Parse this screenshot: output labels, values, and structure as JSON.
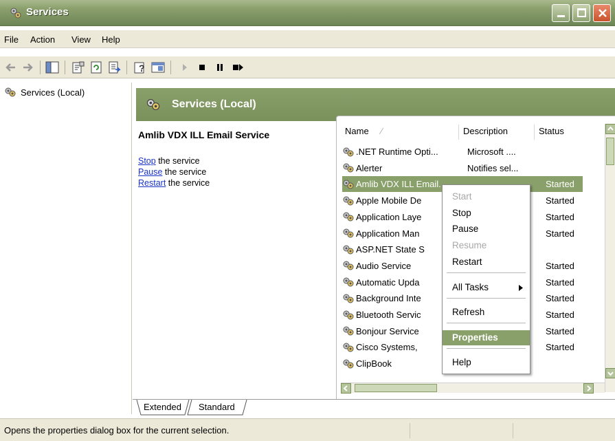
{
  "window": {
    "title": "Services"
  },
  "menu": [
    "File",
    "Action",
    "View",
    "Help"
  ],
  "tree": {
    "root": "Services (Local)"
  },
  "header": {
    "title": "Services (Local)"
  },
  "details": {
    "service_name": "Amlib VDX ILL Email Service",
    "actions": [
      {
        "link": "Stop",
        "rest": " the service"
      },
      {
        "link": "Pause",
        "rest": " the service"
      },
      {
        "link": "Restart",
        "rest": " the service"
      }
    ]
  },
  "list": {
    "columns": [
      "Name",
      "Description",
      "Status"
    ],
    "rows": [
      {
        "name": ".NET Runtime Opti...",
        "description": "Microsoft ....",
        "status": ""
      },
      {
        "name": "Alerter",
        "description": "Notifies sel...",
        "status": ""
      },
      {
        "name": "Amlib VDX ILL Email...",
        "description": "",
        "status": "Started"
      },
      {
        "name": "Apple Mobile De",
        "description": "",
        "status": "Started"
      },
      {
        "name": "Application Laye",
        "description": "",
        "status": "Started"
      },
      {
        "name": "Application Man",
        "description": "",
        "status": "Started"
      },
      {
        "name": "ASP.NET State S",
        "description": "",
        "status": ""
      },
      {
        "name": "Audio Service",
        "description": "",
        "status": "Started"
      },
      {
        "name": "Automatic Upda",
        "description": "",
        "status": "Started"
      },
      {
        "name": "Background Inte",
        "description": "",
        "status": "Started"
      },
      {
        "name": "Bluetooth Servic",
        "description": "",
        "status": "Started"
      },
      {
        "name": "Bonjour Service",
        "description": "",
        "status": "Started"
      },
      {
        "name": "Cisco Systems,",
        "description": "",
        "status": "Started"
      },
      {
        "name": "ClipBook",
        "description": "",
        "status": ""
      }
    ]
  },
  "context_menu": {
    "items": [
      "Start",
      "Stop",
      "Pause",
      "Resume",
      "Restart",
      "All Tasks",
      "Refresh",
      "Properties",
      "Help"
    ]
  },
  "tabs": [
    "Extended",
    "Standard"
  ],
  "statusbar": {
    "text": "Opens the properties dialog box for the current selection."
  },
  "colors": {
    "accent": "#8aa06b",
    "title_bar": "#7b915c",
    "link": "#1a33c4"
  }
}
